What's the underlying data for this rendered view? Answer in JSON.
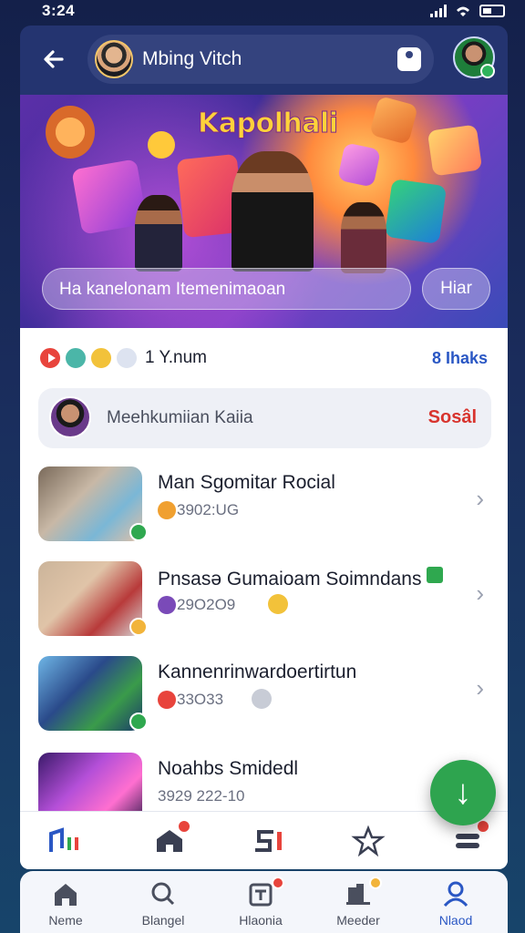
{
  "status_bar": {
    "time": "3:24"
  },
  "header": {
    "user_name": "Mbing Vitch",
    "icons": [
      "back-arrow-icon",
      "user-card-icon",
      "profile-avatar"
    ]
  },
  "hero": {
    "title": "Kapolhali",
    "search_placeholder": "Ha kanelonam Itemenimaoan",
    "button_label": "Hiar"
  },
  "stats": {
    "count_label": "1 Y.num",
    "link_label": "8 Ihaks"
  },
  "social_card": {
    "text": "Meehkumiian Kaiia",
    "action": "Sosâl"
  },
  "list": [
    {
      "title": "Man Sgomitar Rocial",
      "subtitle": "3902:UG",
      "sub_icon_color": "#f0a030"
    },
    {
      "title": "Pnsasə Gumaioam Soimndans",
      "subtitle": "29O2O9",
      "sub_icon_color": "#7a4ab8"
    },
    {
      "title": "Kannenrinwardoertirtun",
      "subtitle": "33O33",
      "sub_icon_color": "#e8443c"
    },
    {
      "title": "Noahbs Smidedl",
      "subtitle": "3929 222-10",
      "sub_icon_color": "#8a8fa0"
    }
  ],
  "fab": {
    "icon": "download-arrow-icon",
    "glyph": "↓"
  },
  "bottom_nav": [
    {
      "label": "Neme",
      "icon": "home-icon",
      "active": false
    },
    {
      "label": "Blangel",
      "icon": "search-icon",
      "active": false
    },
    {
      "label": "Hlaonia",
      "icon": "inbox-icon",
      "active": false
    },
    {
      "label": "Meeder",
      "icon": "folder-icon",
      "active": false
    },
    {
      "label": "Nlaod",
      "icon": "profile-icon",
      "active": true
    }
  ],
  "colors": {
    "accent": "#2a57c4",
    "action_red": "#d8342e",
    "fab_green": "#2ea44f",
    "header_bg": "#243470"
  }
}
